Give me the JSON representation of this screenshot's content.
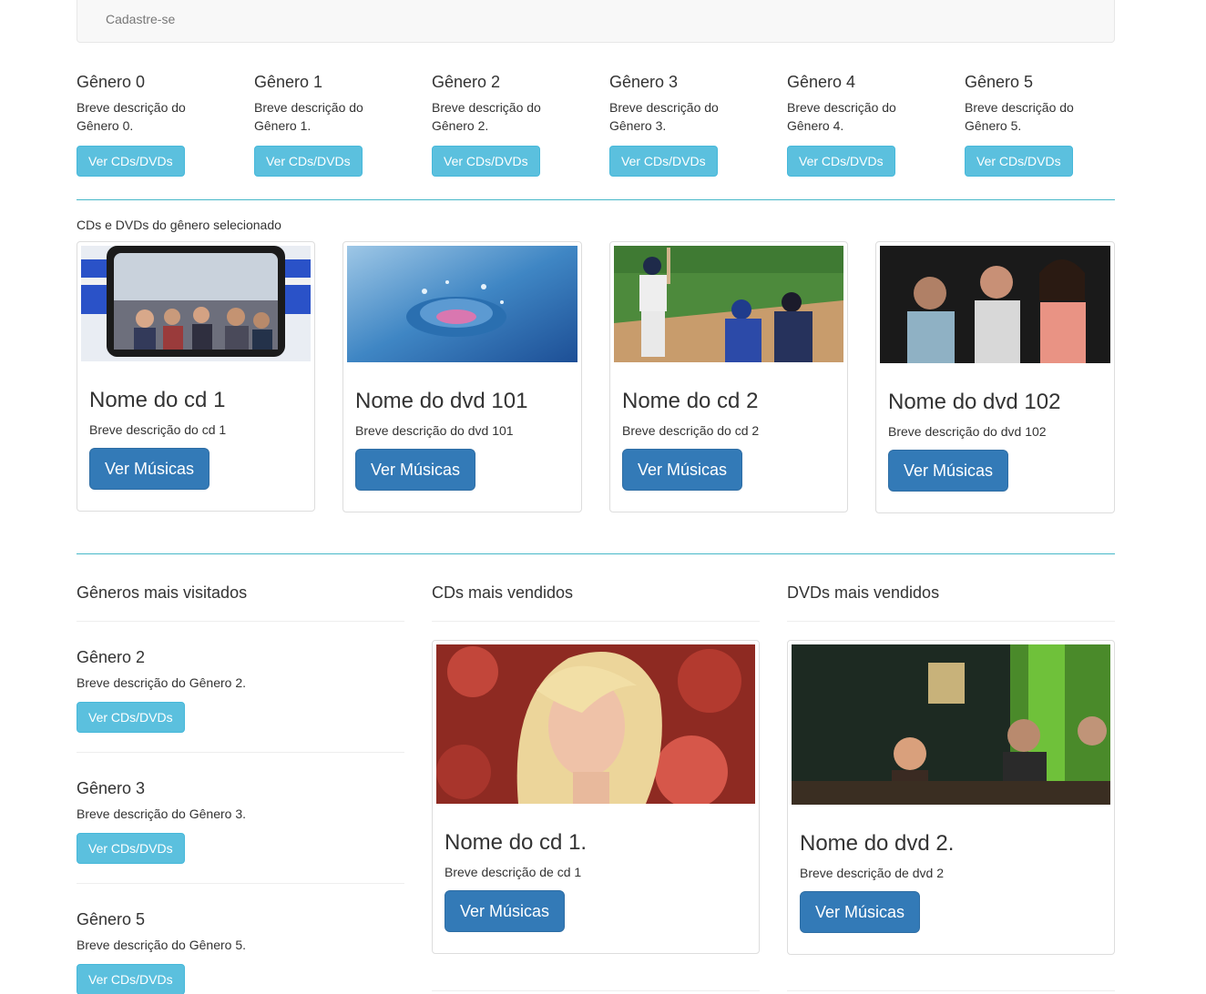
{
  "navbar": {
    "register_link": "Cadastre-se"
  },
  "genres": [
    {
      "title": "Gênero 0",
      "description": "Breve descrição do Gênero 0.",
      "button": "Ver CDs/DVDs"
    },
    {
      "title": "Gênero 1",
      "description": "Breve descrição do Gênero 1.",
      "button": "Ver CDs/DVDs"
    },
    {
      "title": "Gênero 2",
      "description": "Breve descrição do Gênero 2.",
      "button": "Ver CDs/DVDs"
    },
    {
      "title": "Gênero 3",
      "description": "Breve descrição do Gênero 3.",
      "button": "Ver CDs/DVDs"
    },
    {
      "title": "Gênero 4",
      "description": "Breve descrição do Gênero 4.",
      "button": "Ver CDs/DVDs"
    },
    {
      "title": "Gênero 5",
      "description": "Breve descrição do Gênero 5.",
      "button": "Ver CDs/DVDs"
    }
  ],
  "selected": {
    "label": "CDs e DVDs do gênero selecionado",
    "items": [
      {
        "title": "Nome do cd 1",
        "description": "Breve descrição do cd 1",
        "button": "Ver Músicas"
      },
      {
        "title": "Nome do dvd 101",
        "description": "Breve descrição do dvd 101",
        "button": "Ver Músicas"
      },
      {
        "title": "Nome do cd 2",
        "description": "Breve descrição do cd 2",
        "button": "Ver Músicas"
      },
      {
        "title": "Nome do dvd 102",
        "description": "Breve descrição do dvd 102",
        "button": "Ver Músicas"
      }
    ]
  },
  "most_visited": {
    "title": "Gêneros mais visitados",
    "items": [
      {
        "title": "Gênero 2",
        "description": "Breve descrição do Gênero 2.",
        "button": "Ver CDs/DVDs"
      },
      {
        "title": "Gênero 3",
        "description": "Breve descrição do Gênero 3.",
        "button": "Ver CDs/DVDs"
      },
      {
        "title": "Gênero 5",
        "description": "Breve descrição do Gênero 5.",
        "button": "Ver CDs/DVDs"
      }
    ]
  },
  "top_cds": {
    "title": "CDs mais vendidos",
    "item": {
      "title": "Nome do cd 1.",
      "description": "Breve descrição de cd 1",
      "button": "Ver Músicas"
    }
  },
  "top_dvds": {
    "title": "DVDs mais vendidos",
    "item": {
      "title": "Nome do dvd 2.",
      "description": "Breve descrição de dvd 2",
      "button": "Ver Músicas"
    }
  },
  "colors": {
    "info": "#5bc0de",
    "primary": "#337ab7",
    "divider": "#46b8c8"
  }
}
